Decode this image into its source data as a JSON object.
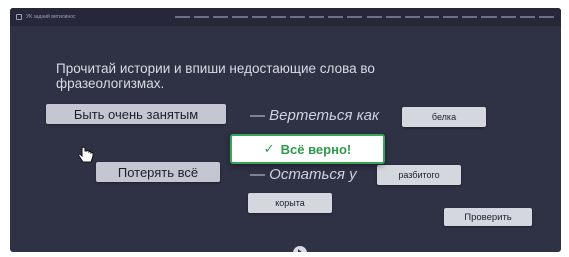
{
  "topbar": {
    "title": "УК задний витилинос",
    "progress_total": 20,
    "progress_done": 0
  },
  "instruction": "Прочитай истории и впиши недостающие слова во фразеологизмах.",
  "idioms": [
    {
      "phrase": "Быть очень занятым",
      "completion": "— Вертеться как",
      "answer": "белка"
    },
    {
      "phrase": "Потерять всё",
      "completion": "— Остаться у",
      "answer": "разбитого"
    }
  ],
  "word_bank": [
    "корыта"
  ],
  "feedback": {
    "text": "Всё верно!",
    "icon": "check-icon"
  },
  "check_button": "Проверить",
  "icons": {
    "cursor": "hand-pointer-icon",
    "play": "play-icon",
    "logo": "app-logo-icon"
  },
  "colors": {
    "background": "#2f3144",
    "chip": "#c4c7d2",
    "success": "#3aa55a"
  }
}
